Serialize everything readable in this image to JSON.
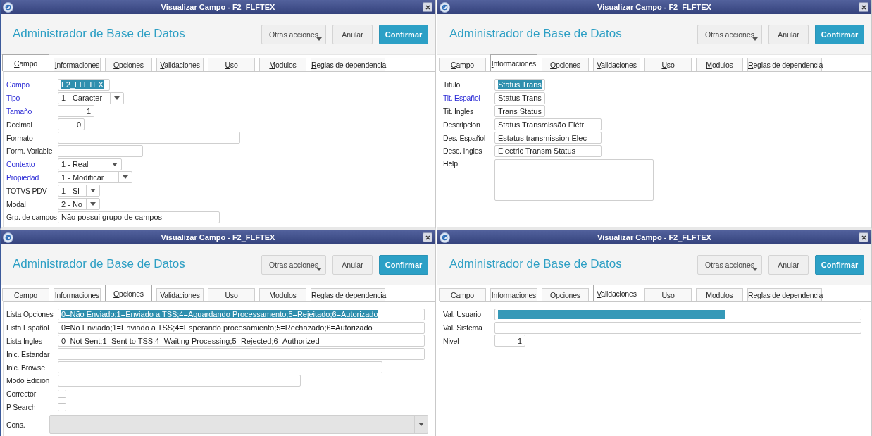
{
  "windows": [
    {
      "title": "Visualizar Campo - F2_FLFTEX",
      "heading": "Administrador de Base de Datos",
      "buttons": [
        {
          "label": "Otras acciones",
          "kind": "menu"
        },
        {
          "label": "Anular",
          "kind": "plain"
        },
        {
          "label": "Confirmar",
          "kind": "primary"
        }
      ],
      "tabs": [
        {
          "label": "Campo",
          "selected": true
        },
        {
          "label": "Informaciones",
          "selected": false
        },
        {
          "label": "Opciones",
          "selected": false
        },
        {
          "label": "Validaciones",
          "selected": false
        },
        {
          "label": "Uso",
          "selected": false
        },
        {
          "label": "Modulos",
          "selected": false
        },
        {
          "label": "Reglas de dependencia",
          "selected": false
        }
      ],
      "fields": [
        {
          "label": "Campo",
          "required": true,
          "kind": "text",
          "value": "F2_FLFTEX",
          "highlighted": true
        },
        {
          "label": "Tipo",
          "required": true,
          "kind": "select",
          "value": "1 - Caracter"
        },
        {
          "label": "Tamaño",
          "required": true,
          "kind": "number",
          "value": "1"
        },
        {
          "label": "Decimal",
          "required": false,
          "kind": "number",
          "value": "0"
        },
        {
          "label": "Formato",
          "required": false,
          "kind": "text"
        },
        {
          "label": "Form. Variable",
          "required": false,
          "kind": "text"
        },
        {
          "label": "Contexto",
          "required": true,
          "kind": "select",
          "value": "1 - Real"
        },
        {
          "label": "Propiedad",
          "required": true,
          "kind": "select",
          "value": "1 - Modificar"
        },
        {
          "label": "TOTVS PDV",
          "required": false,
          "kind": "select",
          "value": "1 - Si"
        },
        {
          "label": "Modal",
          "required": false,
          "kind": "select",
          "value": "2 - No"
        },
        {
          "label": "Grp. de campos",
          "required": false,
          "kind": "text",
          "value": "Não possui grupo de campos"
        }
      ]
    },
    {
      "title": "Visualizar Campo - F2_FLFTEX",
      "heading": "Administrador de Base de Datos",
      "buttons": [
        {
          "label": "Otras acciones",
          "kind": "menu"
        },
        {
          "label": "Anular",
          "kind": "plain"
        },
        {
          "label": "Confirmar",
          "kind": "primary"
        }
      ],
      "tabs": [
        {
          "label": "Campo",
          "selected": false
        },
        {
          "label": "Informaciones",
          "selected": true
        },
        {
          "label": "Opciones",
          "selected": false
        },
        {
          "label": "Validaciones",
          "selected": false
        },
        {
          "label": "Uso",
          "selected": false
        },
        {
          "label": "Modulos",
          "selected": false
        },
        {
          "label": "Reglas de dependencia",
          "selected": false
        }
      ],
      "fields": [
        {
          "label": "Titulo",
          "required": false,
          "kind": "text",
          "value": "Status Trans",
          "highlighted": true
        },
        {
          "label": "Tit. Español",
          "required": true,
          "kind": "text",
          "value": "Status Trans"
        },
        {
          "label": "Tit. Ingles",
          "required": false,
          "kind": "text",
          "value": "Trans Status"
        },
        {
          "label": "Descripcion",
          "required": false,
          "kind": "text",
          "value": "Status Transmissão Elétr"
        },
        {
          "label": "Des. Español",
          "required": false,
          "kind": "text",
          "value": "Estatus transmission Elec"
        },
        {
          "label": "Desc. Ingles",
          "required": false,
          "kind": "text",
          "value": "Electric Transm Status"
        },
        {
          "label": "Help",
          "required": false,
          "kind": "textarea"
        }
      ]
    },
    {
      "title": "Visualizar Campo - F2_FLFTEX",
      "heading": "Administrador de Base de Datos",
      "buttons": [
        {
          "label": "Otras acciones",
          "kind": "menu"
        },
        {
          "label": "Anular",
          "kind": "plain"
        },
        {
          "label": "Confirmar",
          "kind": "primary"
        }
      ],
      "tabs": [
        {
          "label": "Campo",
          "selected": false
        },
        {
          "label": "Informaciones",
          "selected": false
        },
        {
          "label": "Opciones",
          "selected": true
        },
        {
          "label": "Validaciones",
          "selected": false
        },
        {
          "label": "Uso",
          "selected": false
        },
        {
          "label": "Modulos",
          "selected": false
        },
        {
          "label": "Reglas de dependencia",
          "selected": false
        }
      ],
      "fields": [
        {
          "label": "Lista Opciones",
          "required": false,
          "kind": "text",
          "value": "0=Não Enviado;1=Enviado a TSS;4=Aguardando Processamento;5=Rejeitado;6=Autorizado",
          "highlighted": true
        },
        {
          "label": "Lista Español",
          "required": false,
          "kind": "text",
          "value": "0=No Enviado;1=Enviado a TSS;4=Esperando procesamiento;5=Rechazado;6=Autorizado"
        },
        {
          "label": "Lista Ingles",
          "required": false,
          "kind": "text",
          "value": "0=Not Sent;1=Sent to TSS;4=Waiting Processing;5=Rejected;6=Authorized"
        },
        {
          "label": "Inic. Estandar",
          "required": false,
          "kind": "text"
        },
        {
          "label": "Inic. Browse",
          "required": false,
          "kind": "text"
        },
        {
          "label": "Modo Edicion",
          "required": false,
          "kind": "text"
        },
        {
          "label": "Corrector",
          "required": false,
          "kind": "checkbox",
          "checked": false
        },
        {
          "label": "P Search",
          "required": false,
          "kind": "checkbox",
          "checked": false
        },
        {
          "label": "Cons.",
          "required": false,
          "kind": "lookup",
          "disabled": true
        }
      ]
    },
    {
      "title": "Visualizar Campo - F2_FLFTEX",
      "heading": "Administrador de Base de Datos",
      "buttons": [
        {
          "label": "Otras acciones",
          "kind": "menu"
        },
        {
          "label": "Anular",
          "kind": "plain"
        },
        {
          "label": "Confirmar",
          "kind": "primary"
        }
      ],
      "tabs": [
        {
          "label": "Campo",
          "selected": false
        },
        {
          "label": "Informaciones",
          "selected": false
        },
        {
          "label": "Opciones",
          "selected": false
        },
        {
          "label": "Validaciones",
          "selected": true
        },
        {
          "label": "Uso",
          "selected": false
        },
        {
          "label": "Modulos",
          "selected": false
        },
        {
          "label": "Reglas de dependencia",
          "selected": false
        }
      ],
      "fields": [
        {
          "label": "Val. Usuario",
          "required": false,
          "kind": "text",
          "highlighted": true
        },
        {
          "label": "Val. Sistema",
          "required": false,
          "kind": "text"
        },
        {
          "label": "Nivel",
          "required": false,
          "kind": "number",
          "value": "1"
        }
      ]
    }
  ]
}
